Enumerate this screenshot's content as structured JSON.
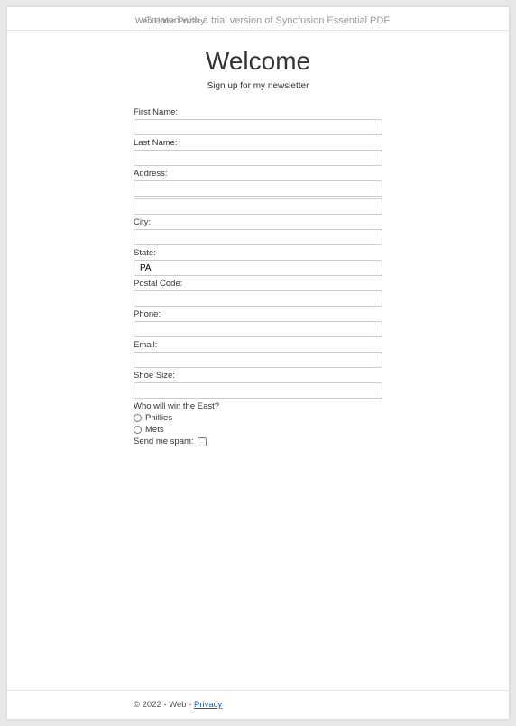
{
  "header": {
    "nav_text": "Web    Home    Privacy",
    "watermark": "Created with a trial version of Syncfusion Essential PDF"
  },
  "main": {
    "title": "Welcome",
    "subtitle": "Sign up for my newsletter",
    "fields": {
      "first_name_label": "First Name:",
      "first_name_value": "",
      "last_name_label": "Last Name:",
      "last_name_value": "",
      "address_label": "Address:",
      "address_value1": "",
      "address_value2": "",
      "city_label": "City:",
      "city_value": "",
      "state_label": "State:",
      "state_value": "PA",
      "postal_label": "Postal Code:",
      "postal_value": "",
      "phone_label": "Phone:",
      "phone_value": "",
      "email_label": "Email:",
      "email_value": "",
      "shoe_label": "Shoe Size:",
      "shoe_value": ""
    },
    "question": {
      "label": "Who will win the East?",
      "option1": "Phillies",
      "option2": "Mets"
    },
    "spam": {
      "label": "Send me spam:"
    }
  },
  "footer": {
    "copyright": "© 2022 - Web - ",
    "privacy_link": "Privacy"
  }
}
